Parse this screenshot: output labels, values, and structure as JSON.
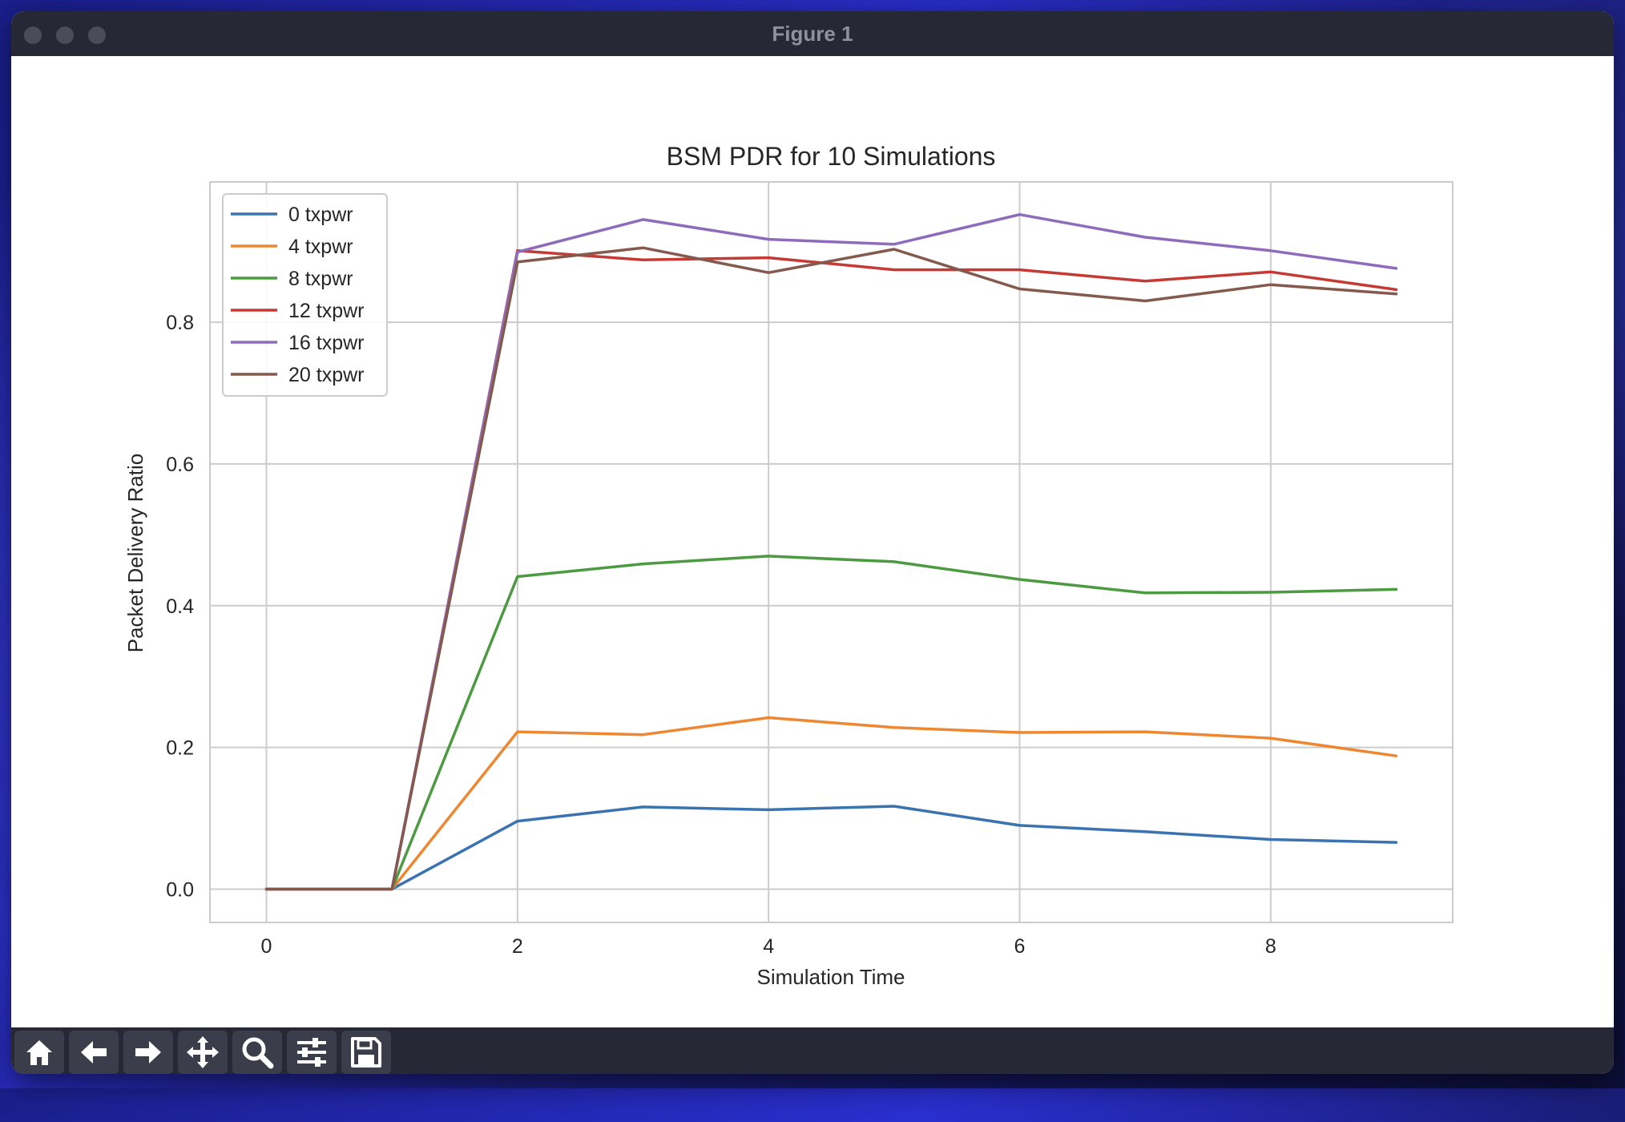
{
  "window": {
    "title": "Figure 1"
  },
  "toolbar": [
    {
      "icon": "home-icon",
      "label": "Home"
    },
    {
      "icon": "arrow-left-icon",
      "label": "Back"
    },
    {
      "icon": "arrow-right-icon",
      "label": "Forward"
    },
    {
      "icon": "move-icon",
      "label": "Pan"
    },
    {
      "icon": "search-icon",
      "label": "Zoom"
    },
    {
      "icon": "sliders-icon",
      "label": "Configure subplots"
    },
    {
      "icon": "save-icon",
      "label": "Save"
    }
  ],
  "chart_data": {
    "type": "line",
    "title": "BSM PDR for 10 Simulations",
    "xlabel": "Simulation Time",
    "ylabel": "Packet Delivery Ratio",
    "xlim": [
      -0.45,
      9.45
    ],
    "ylim": [
      -0.047,
      0.998
    ],
    "xticks": [
      0,
      2,
      4,
      6,
      8
    ],
    "xtick_labels": [
      "0",
      "2",
      "4",
      "6",
      "8"
    ],
    "yticks": [
      0.0,
      0.2,
      0.4,
      0.6,
      0.8
    ],
    "ytick_labels": [
      "0.0",
      "0.2",
      "0.4",
      "0.6",
      "0.8"
    ],
    "grid": true,
    "legend_position": "top-left",
    "x": [
      0,
      1,
      2,
      3,
      4,
      5,
      6,
      7,
      8,
      9
    ],
    "series": [
      {
        "name": "0 txpwr",
        "color": "#3a73b0",
        "values": [
          0,
          0,
          0.096,
          0.116,
          0.112,
          0.117,
          0.09,
          0.081,
          0.07,
          0.066
        ]
      },
      {
        "name": "4 txpwr",
        "color": "#ee8732",
        "values": [
          0,
          0,
          0.222,
          0.218,
          0.242,
          0.228,
          0.221,
          0.222,
          0.213,
          0.188
        ]
      },
      {
        "name": "8 txpwr",
        "color": "#4c9a41",
        "values": [
          0,
          0,
          0.441,
          0.459,
          0.47,
          0.462,
          0.437,
          0.418,
          0.419,
          0.423
        ]
      },
      {
        "name": "12 txpwr",
        "color": "#c53a34",
        "values": [
          0,
          0,
          0.901,
          0.888,
          0.891,
          0.874,
          0.874,
          0.858,
          0.871,
          0.846
        ]
      },
      {
        "name": "16 txpwr",
        "color": "#8f6bbb",
        "values": [
          0,
          0,
          0.899,
          0.945,
          0.917,
          0.91,
          0.952,
          0.92,
          0.901,
          0.876
        ]
      },
      {
        "name": "20 txpwr",
        "color": "#845a4e",
        "values": [
          0,
          0,
          0.885,
          0.905,
          0.87,
          0.903,
          0.847,
          0.83,
          0.853,
          0.84
        ]
      }
    ]
  }
}
